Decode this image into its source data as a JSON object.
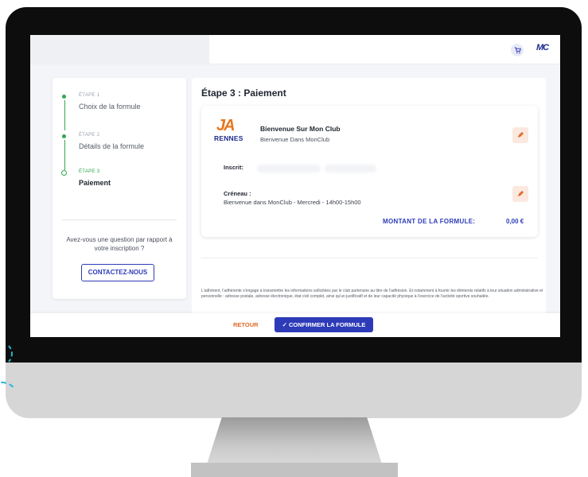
{
  "header": {
    "logo_text": "MC",
    "cart_icon": "cart-icon"
  },
  "stepper": {
    "steps": [
      {
        "step_label": "ÉTAPE 1",
        "title": "Choix de la formule",
        "state": "done"
      },
      {
        "step_label": "ÉTAPE 2",
        "title": "Détails de la formule",
        "state": "done"
      },
      {
        "step_label": "ÉTAPE 3",
        "title": "Paiement",
        "state": "active"
      }
    ],
    "question": "Avez-vous une question par rapport à votre inscription ?",
    "contact_label": "CONTACTEZ-NOUS"
  },
  "main": {
    "title": "Étape 3 : Paiement",
    "club": {
      "logo_text": "JA",
      "logo_sub": "RENNES",
      "name": "Bienvenue Sur Mon Club",
      "subtitle": "Bienvenue Dans MonClub"
    },
    "inscrit_label": "Inscrit:",
    "creneau_label": "Créneau :",
    "creneau_value": "Bienvenue dans MonClub - Mercredi - 14h00-15h00",
    "montant_label": "MONTANT DE LA FORMULE:",
    "montant_value": "0,00 €",
    "legal_text": "L'adhérent, l'adhérente s'engage à transmettre les informations sollicitées par le club partenaire au titre de l'adhésion. Et notamment à fournir les éléments relatifs à leur situation administrative et personnelle : adresse postale, adresse électronique, état civil complet, ainsi qu'un justificatif et de leur capacité physique à l'exercice de l'activité sportive souhaitée."
  },
  "footer": {
    "retour_label": "RETOUR",
    "confirm_label": "✓  CONFIRMER LA FORMULE"
  },
  "colors": {
    "accent": "#2d3bb8",
    "success": "#2ea84f",
    "warning": "#e06a2a",
    "bezel": "#0d0d0d"
  }
}
